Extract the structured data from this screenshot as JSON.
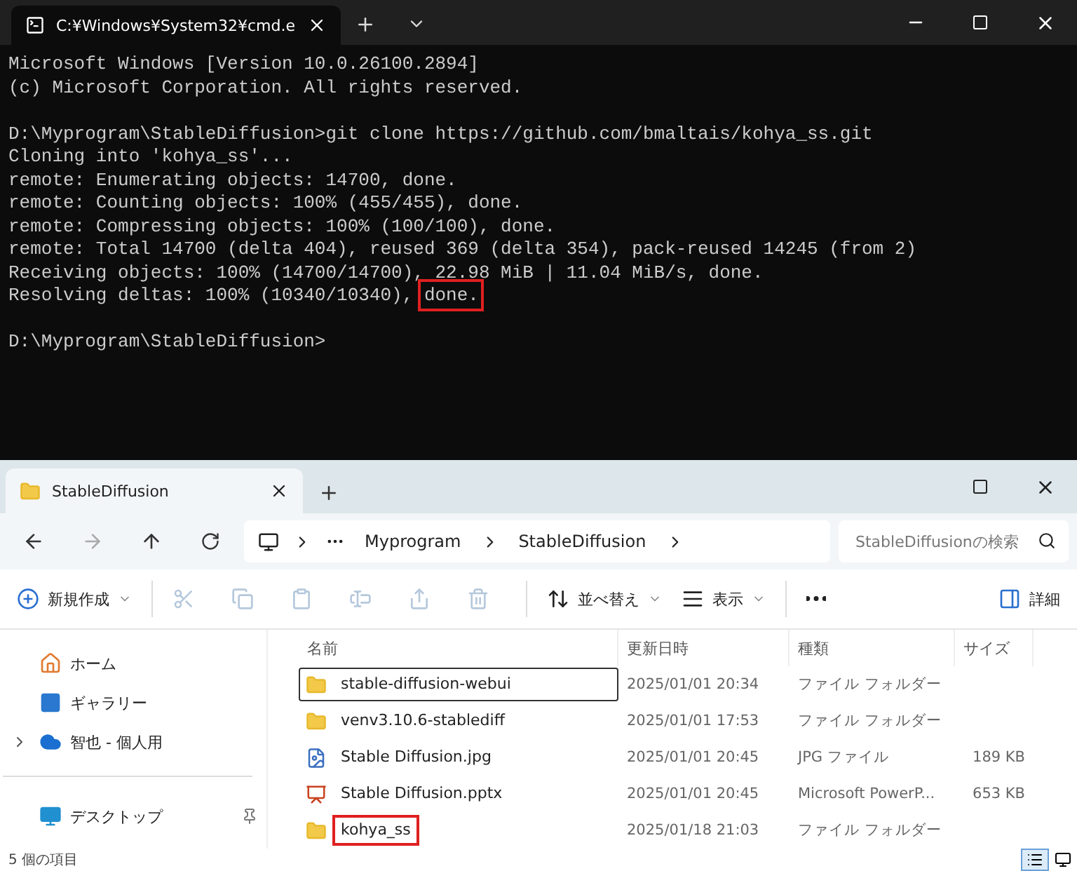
{
  "terminal": {
    "tab_title": "C:¥Windows¥System32¥cmd.e",
    "blocks": [
      [
        {
          "text": "Microsoft Windows [Version 10.0.26100.2894]"
        },
        {
          "text": "(c) Microsoft Corporation. All rights reserved."
        }
      ],
      [
        {
          "text": "D:\\Myprogram\\StableDiffusion>git clone https://github.com/bmaltais/kohya_ss.git"
        },
        {
          "text": "Cloning into 'kohya_ss'..."
        },
        {
          "text": "remote: Enumerating objects: 14700, done."
        },
        {
          "text": "remote: Counting objects: 100% (455/455), done."
        },
        {
          "text": "remote: Compressing objects: 100% (100/100), done."
        },
        {
          "text": "remote: Total 14700 (delta 404), reused 369 (delta 354), pack-reused 14245 (from 2)"
        },
        {
          "text": "Receiving objects: 100% (14700/14700), 22.98 MiB | 11.04 MiB/s, done."
        },
        {
          "text": "Resolving deltas: 100% (10340/10340), ",
          "marked": "done."
        }
      ],
      [
        {
          "text": "D:\\Myprogram\\StableDiffusion>"
        }
      ]
    ]
  },
  "explorer": {
    "tab_title": "StableDiffusion",
    "breadcrumb": [
      "Myprogram",
      "StableDiffusion"
    ],
    "search": {
      "placeholder": "StableDiffusionの検索"
    },
    "toolbar": [
      {
        "kind": "new",
        "label": "新規作成",
        "disabled": false
      },
      {
        "kind": "cut",
        "disabled": true
      },
      {
        "kind": "copy",
        "disabled": true
      },
      {
        "kind": "paste",
        "disabled": true
      },
      {
        "kind": "rename",
        "disabled": true
      },
      {
        "kind": "share",
        "disabled": true
      },
      {
        "kind": "delete",
        "disabled": true
      },
      {
        "kind": "sort",
        "label": "並べ替え",
        "disabled": false
      },
      {
        "kind": "view",
        "label": "表示",
        "disabled": false
      },
      {
        "kind": "more",
        "disabled": false
      }
    ],
    "details_button": "詳細",
    "sidebar": [
      {
        "kind": "home",
        "label": "ホーム"
      },
      {
        "kind": "gallery",
        "label": "ギャラリー"
      },
      {
        "kind": "cloud",
        "label": "智也 - 個人用",
        "expandable": true
      },
      {
        "kind": "desktop",
        "label": "デスクトップ",
        "pinned": true
      }
    ],
    "columns": [
      "名前",
      "更新日時",
      "種類",
      "サイズ"
    ],
    "files": [
      {
        "kind": "folder",
        "name": "stable-diffusion-webui",
        "date": "2025/01/01 20:34",
        "type": "ファイル フォルダー",
        "focused": true,
        "marked": false
      },
      {
        "kind": "folder",
        "name": "venv3.10.6-stablediff",
        "date": "2025/01/01 17:53",
        "type": "ファイル フォルダー",
        "focused": false
      },
      {
        "kind": "image",
        "name": "Stable Diffusion.jpg",
        "date": "2025/01/01 20:45",
        "type": "JPG ファイル",
        "size": "189 KB",
        "focused": false
      },
      {
        "kind": "slides",
        "name": "Stable Diffusion.pptx",
        "date": "2025/01/01 20:45",
        "type": "Microsoft PowerP...",
        "size": "653 KB",
        "focused": false
      },
      {
        "kind": "folder",
        "name": "kohya_ss",
        "date": "2025/01/18 21:03",
        "type": "ファイル フォルダー",
        "focused": false,
        "marked": true
      }
    ],
    "status": "5 個の項目"
  }
}
